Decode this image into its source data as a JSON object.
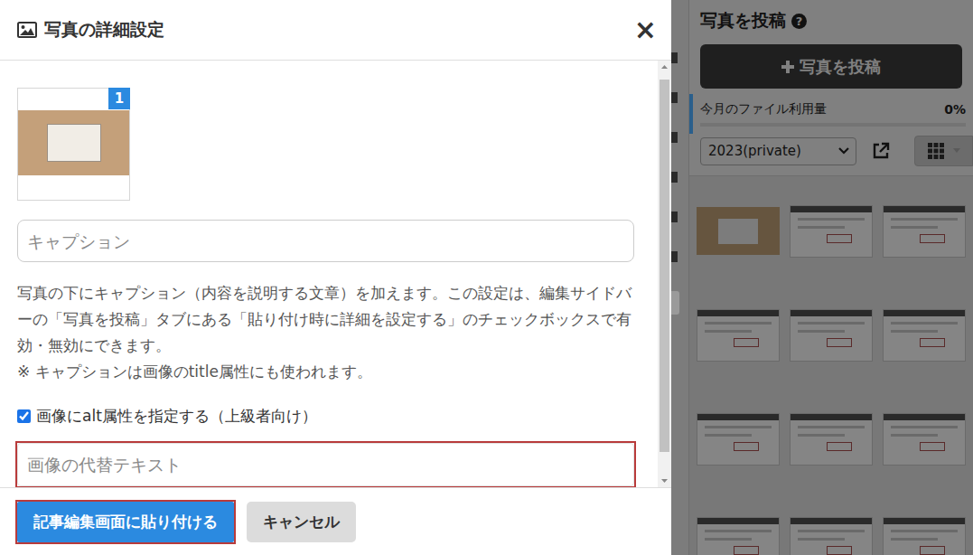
{
  "dialog": {
    "title": "写真の詳細設定",
    "close": "×",
    "photo": {
      "badge": "1"
    },
    "caption": {
      "placeholder": "キャプション"
    },
    "description": "写真の下にキャプション（内容を説明する文章）を加えます。この設定は、編集サイドバーの「写真を投稿」タブにある「貼り付け時に詳細を設定する」のチェックボックスで有効・無効にできます。",
    "note": "※ キャプションは画像のtitle属性にも使われます。",
    "alt_checkbox": {
      "label": "画像にalt属性を指定する（上級者向け）",
      "checked": true
    },
    "alt_input": {
      "placeholder": "画像の代替テキスト",
      "highlighted": true
    },
    "buttons": [
      {
        "label": "記事編集画面に貼り付ける",
        "kind": "primary",
        "highlighted": true
      },
      {
        "label": "キャンセル",
        "kind": "secondary",
        "highlighted": false
      }
    ]
  },
  "sidebar": {
    "title": "写真を投稿",
    "help_icon": "?",
    "upload_button": "写真を投稿",
    "usage": {
      "label": "今月のファイル利用量",
      "reading": "0%",
      "level": 0
    },
    "folder": {
      "value": "2023(private)"
    },
    "thumbnails": [
      {
        "kind": "photo"
      },
      {
        "kind": "screenshot"
      },
      {
        "kind": "screenshot"
      },
      {
        "kind": "screenshot"
      },
      {
        "kind": "screenshot"
      },
      {
        "kind": "screenshot"
      },
      {
        "kind": "screenshot"
      },
      {
        "kind": "screenshot"
      },
      {
        "kind": "screenshot"
      },
      {
        "kind": "screenshot"
      },
      {
        "kind": "screenshot"
      },
      {
        "kind": "screenshot"
      }
    ]
  }
}
